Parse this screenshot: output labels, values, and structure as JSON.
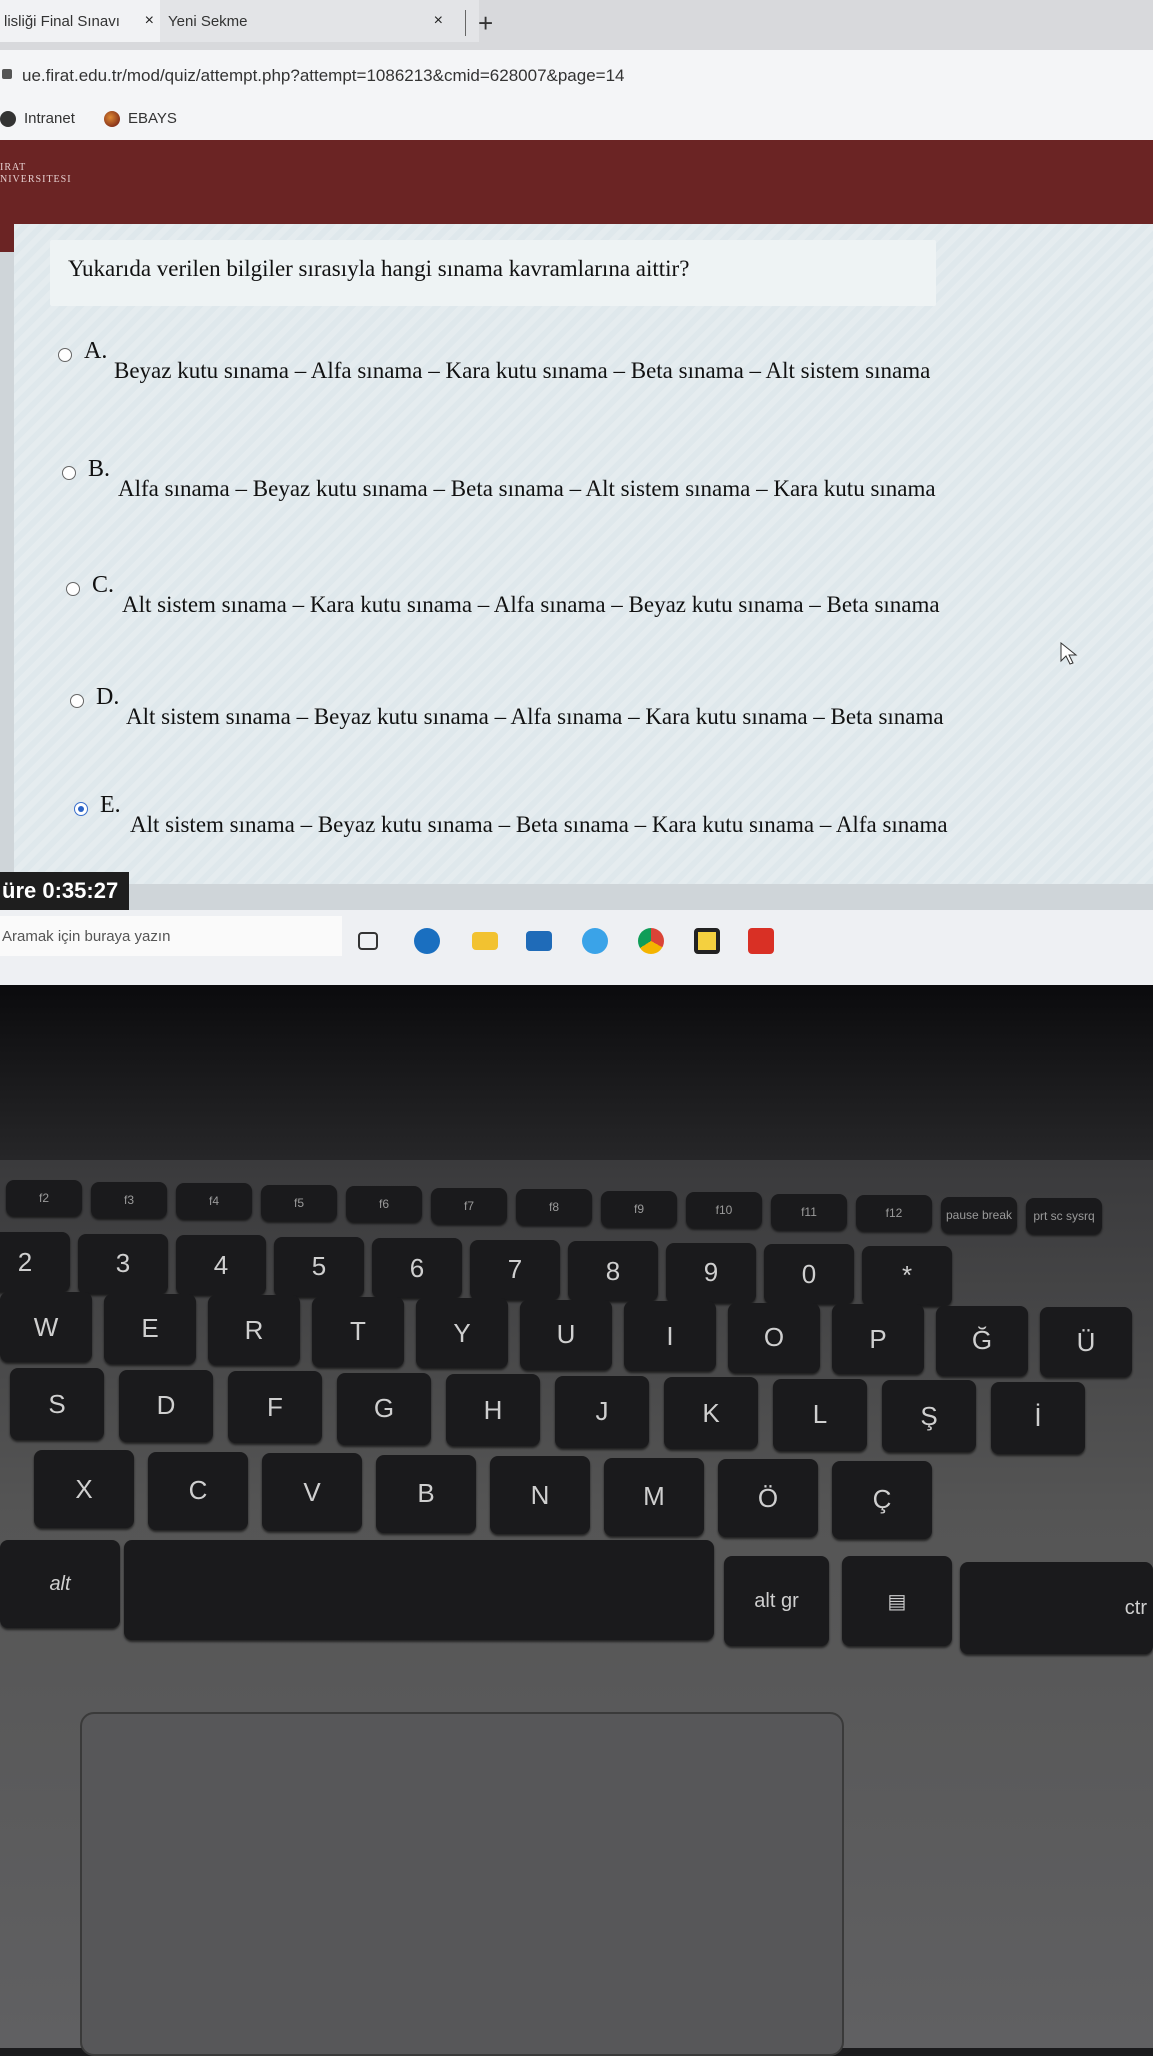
{
  "browser": {
    "tabs": [
      {
        "label": "lisliği Final Sınavı",
        "close": "×"
      },
      {
        "label": "Yeni Sekme",
        "close": "×"
      }
    ],
    "new_tab": "+",
    "url": "ue.firat.edu.tr/mod/quiz/attempt.php?attempt=1086213&cmid=628007&page=14",
    "bookmarks": [
      "Intranet",
      "EBAYS"
    ]
  },
  "site": {
    "logo_line1": "IRAT",
    "logo_line2": "NIVERSITESI"
  },
  "quiz": {
    "question": "Yukarıda verilen bilgiler sırasıyla hangi sınama kavramlarına aittir?",
    "options": [
      {
        "letter": "A.",
        "text": "Beyaz kutu sınama – Alfa sınama – Kara kutu sınama – Beta sınama – Alt sistem sınama",
        "selected": false
      },
      {
        "letter": "B.",
        "text": "Alfa sınama – Beyaz kutu sınama – Beta sınama – Alt sistem sınama – Kara kutu sınama",
        "selected": false
      },
      {
        "letter": "C.",
        "text": "Alt sistem sınama – Kara kutu sınama – Alfa sınama – Beyaz kutu sınama – Beta sınama",
        "selected": false
      },
      {
        "letter": "D.",
        "text": "Alt sistem sınama – Beyaz kutu sınama – Alfa sınama – Kara kutu sınama – Beta sınama",
        "selected": false
      },
      {
        "letter": "E.",
        "text": "Alt sistem sınama – Beyaz kutu sınama – Beta sınama – Kara kutu sınama – Alfa sınama",
        "selected": true
      }
    ],
    "timer": "üre 0:35:27"
  },
  "taskbar": {
    "search_placeholder": "Aramak için buraya yazın",
    "icons": [
      "task-view-icon",
      "edge-icon",
      "file-explorer-icon",
      "mail-icon",
      "ie-icon",
      "chrome-icon",
      "sticky-icon",
      "acrobat-icon"
    ]
  },
  "keyboard": {
    "fkeys": [
      "f2",
      "f3",
      "f4",
      "f5",
      "f6",
      "f7",
      "f8",
      "f9",
      "f10",
      "f11",
      "f12",
      "pause break",
      "prt sc sysrq"
    ],
    "numrow": [
      "2",
      "3",
      "4",
      "5",
      "6",
      "7",
      "8",
      "9",
      "0",
      "*"
    ],
    "row1": [
      "W",
      "E",
      "R",
      "T",
      "Y",
      "U",
      "I",
      "O",
      "P",
      "Ğ",
      "Ü"
    ],
    "row2": [
      "S",
      "D",
      "F",
      "G",
      "H",
      "J",
      "K",
      "L",
      "Ş",
      "İ"
    ],
    "row3": [
      "X",
      "C",
      "V",
      "B",
      "N",
      "M",
      "Ö",
      "Ç"
    ],
    "bottom": [
      "alt",
      "alt gr",
      "ctr"
    ]
  }
}
